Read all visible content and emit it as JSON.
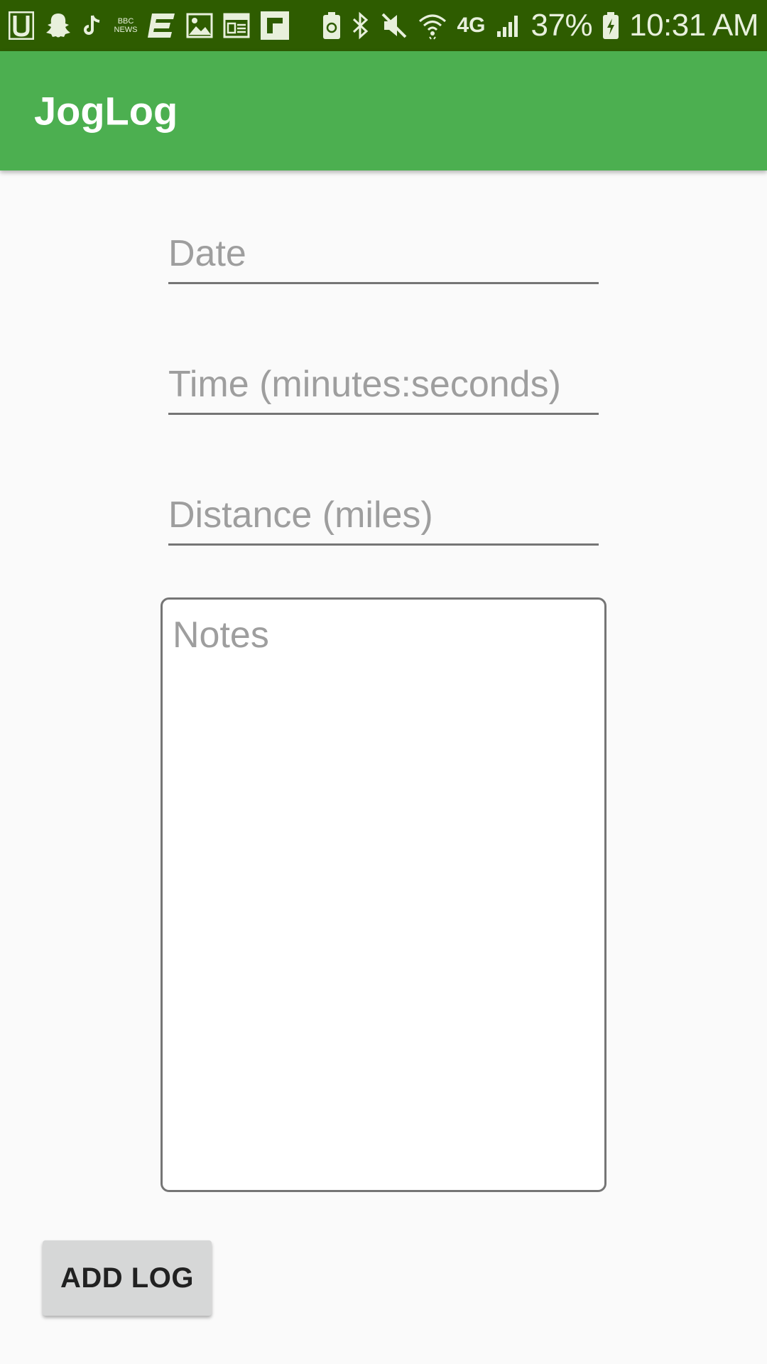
{
  "status_bar": {
    "left_icons": [
      "u-app-icon",
      "snapchat-icon",
      "tiktok-icon",
      "bbc-news-icon",
      "app-e-icon",
      "gallery-icon",
      "news-icon",
      "flipboard-icon"
    ],
    "bbc_news_text": "BBC NEWS",
    "right_icons": [
      "battery-saver-icon",
      "bluetooth-icon",
      "mute-icon",
      "wifi-icon",
      "lte-4g-icon",
      "signal-icon"
    ],
    "network_label": "4G",
    "battery_percent": "37%",
    "battery_icon": "battery-charging-icon",
    "time": "10:31 AM"
  },
  "app_bar": {
    "title": "JogLog",
    "background_color": "#4caf50",
    "status_bar_color": "#2e5c00"
  },
  "form": {
    "date_placeholder": "Date",
    "date_value": "",
    "time_placeholder": "Time (minutes:seconds)",
    "time_value": "",
    "distance_placeholder": "Distance (miles)",
    "distance_value": "",
    "notes_placeholder": "Notes",
    "notes_value": ""
  },
  "actions": {
    "add_log_label": "ADD LOG"
  }
}
